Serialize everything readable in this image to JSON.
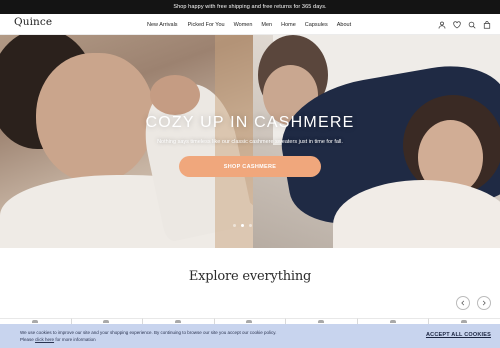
{
  "promo": {
    "text": "Shop happy with free shipping and free returns for 365 days."
  },
  "header": {
    "logo": "Quince",
    "nav": [
      "New Arrivals",
      "Picked For You",
      "Women",
      "Men",
      "Home",
      "Capsules",
      "About"
    ],
    "icons": [
      "user-icon",
      "heart-icon",
      "search-icon",
      "bag-icon"
    ]
  },
  "hero": {
    "title": "COZY UP IN CASHMERE",
    "subtitle": "Nothing says timeless like our classic cashmere sweaters just in time for fall.",
    "cta": "SHOP CASHMERE",
    "slides": 3,
    "active_slide": 1
  },
  "explore": {
    "title": "Explore everything",
    "prev_icon": "chevron-left-icon",
    "next_icon": "chevron-right-icon"
  },
  "cookie": {
    "text_before": "We use cookies to improve our site and your shopping experience. By continuing to browse our site you accept our cookie policy.",
    "text_please": "Please",
    "link": "click here",
    "text_after": "for more information",
    "accept": "ACCEPT ALL COOKIES"
  },
  "colors": {
    "promo_bg": "#141414",
    "cta_bg": "#f0a77c",
    "cookie_bg": "#c8d4ee"
  }
}
